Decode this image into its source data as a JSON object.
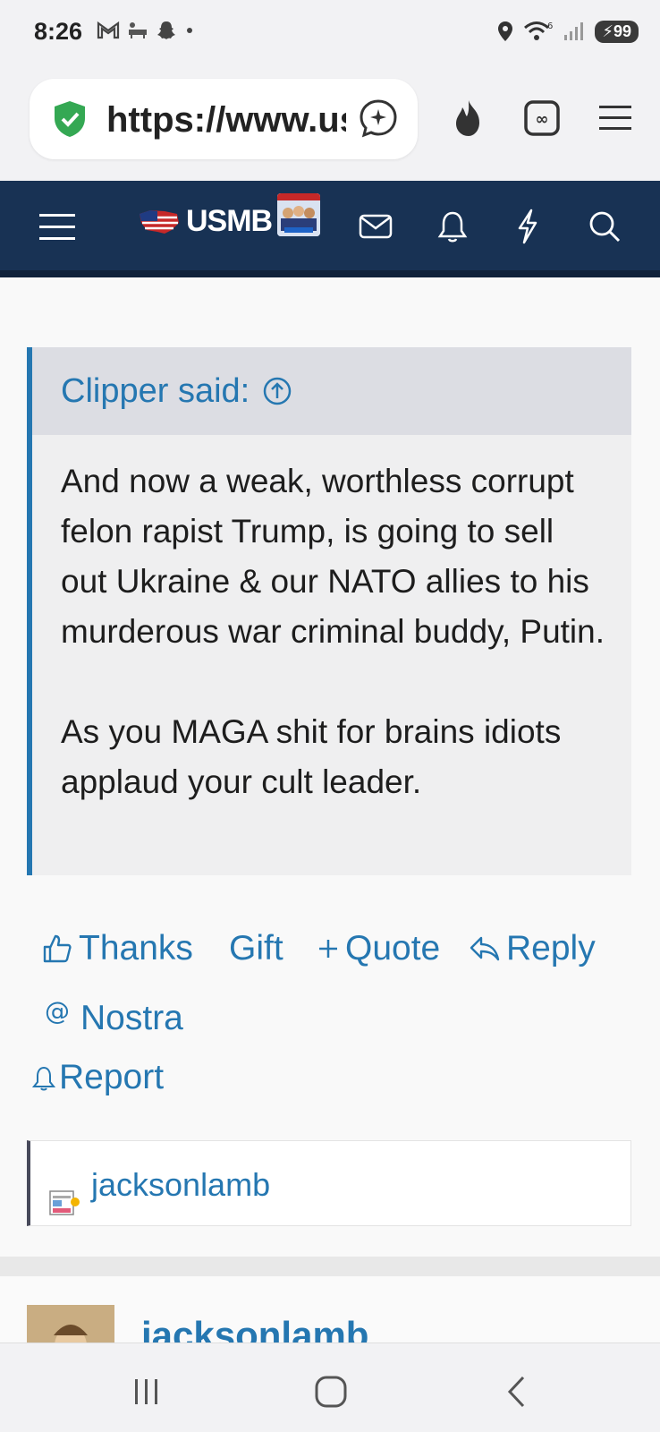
{
  "status_bar": {
    "time": "8:26",
    "battery": "99",
    "network": "6"
  },
  "browser": {
    "url": "https://www.usmessageboard.com"
  },
  "site": {
    "logo_text": "USMB"
  },
  "quote": {
    "author_label": "Clipper said:",
    "paragraphs": [
      "And now a weak, worthless corrupt felon rapist Trump, is going to sell out Ukraine & our NATO allies to his murderous war criminal buddy, Putin.",
      "As you MAGA shit for brains idiots applaud your cult leader."
    ]
  },
  "actions": {
    "thanks": "Thanks",
    "gift": "Gift",
    "quote": "Quote",
    "reply": "Reply",
    "nostra": "Nostra",
    "report": "Report"
  },
  "reactions": {
    "user": "jacksonlamb"
  },
  "next_post": {
    "user": "jacksonlamb"
  },
  "colors": {
    "link": "#2577b1",
    "nav_bg": "#183254",
    "quote_border": "#2577b1"
  }
}
